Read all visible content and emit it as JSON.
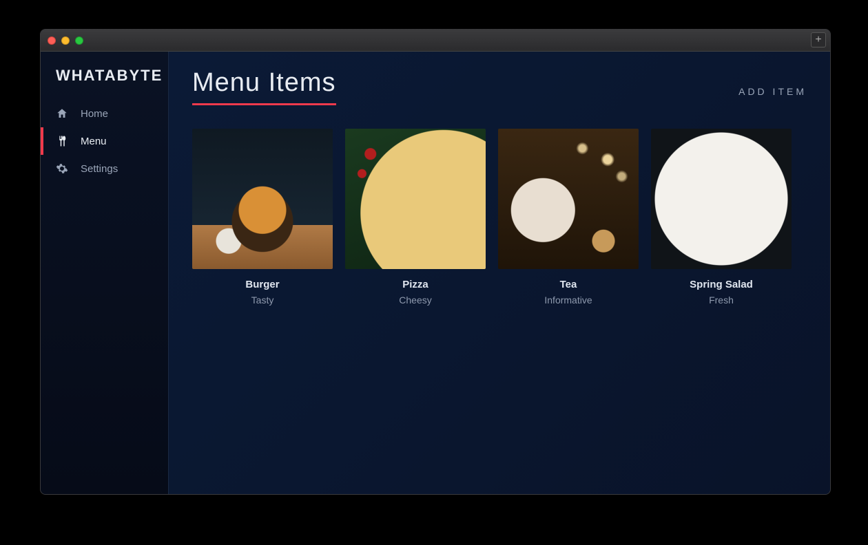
{
  "brand": "WHATABYTE",
  "sidebar": {
    "items": [
      {
        "label": "Home",
        "icon": "home-icon",
        "active": false
      },
      {
        "label": "Menu",
        "icon": "utensils-icon",
        "active": true
      },
      {
        "label": "Settings",
        "icon": "gear-icon",
        "active": false
      }
    ]
  },
  "main": {
    "title": "Menu Items",
    "add_item_label": "ADD ITEM",
    "cards": [
      {
        "name": "Burger",
        "desc": "Tasty",
        "thumb": "thumb-burger"
      },
      {
        "name": "Pizza",
        "desc": "Cheesy",
        "thumb": "thumb-pizza"
      },
      {
        "name": "Tea",
        "desc": "Informative",
        "thumb": "thumb-tea"
      },
      {
        "name": "Spring Salad",
        "desc": "Fresh",
        "thumb": "thumb-salad"
      }
    ]
  },
  "colors": {
    "accent": "#ef3a4c",
    "bg": "#0a1730",
    "sidebar_bg": "#0a1224",
    "text": "#e8ecf2",
    "muted": "#9aa5b8"
  }
}
